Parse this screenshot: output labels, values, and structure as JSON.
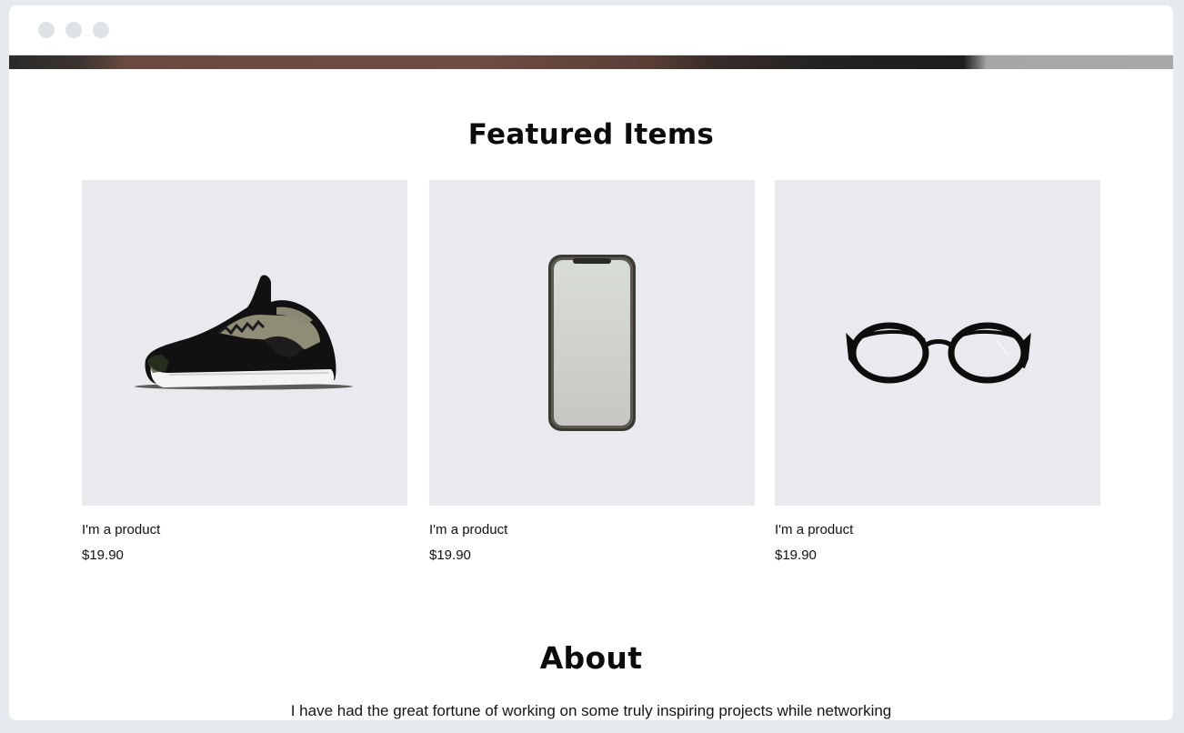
{
  "window": {
    "controls": [
      "window-dot",
      "window-dot",
      "window-dot"
    ]
  },
  "featured": {
    "title": "Featured Items",
    "products": [
      {
        "name": "I'm a product",
        "price": "$19.90",
        "icon": "sneaker-icon"
      },
      {
        "name": "I'm a product",
        "price": "$19.90",
        "icon": "smartphone-icon"
      },
      {
        "name": "I'm a product",
        "price": "$19.90",
        "icon": "eyeglasses-icon"
      }
    ]
  },
  "about": {
    "title": "About",
    "text": "I have had the great fortune of working on some truly inspiring projects while networking"
  },
  "colors": {
    "page_bg": "#e6e9ee",
    "product_bg": "#e9eaed",
    "text": "#111111"
  }
}
